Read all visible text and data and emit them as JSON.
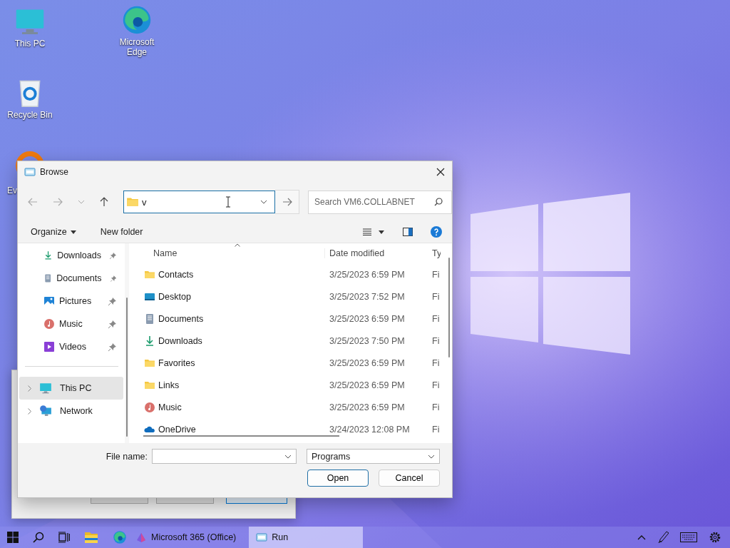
{
  "desktop": {
    "icons": [
      {
        "label": "This PC",
        "kind": "pc"
      },
      {
        "label": "Microsoft Edge",
        "kind": "edge"
      },
      {
        "label": "Recycle Bin",
        "kind": "bin"
      },
      {
        "label": "Ev",
        "kind": "app"
      }
    ]
  },
  "run_dialog": {
    "buttons": [
      {
        "selected": false
      },
      {
        "selected": false
      },
      {
        "selected": true
      }
    ]
  },
  "browse": {
    "title": "Browse",
    "address": "v",
    "search_placeholder": "Search VM6.COLLABNET",
    "toolbar": [
      "Organize",
      "New folder"
    ],
    "sidebar": {
      "quick": [
        {
          "label": "Downloads",
          "kind": "downloads"
        },
        {
          "label": "Documents",
          "kind": "documents"
        },
        {
          "label": "Pictures",
          "kind": "pictures"
        },
        {
          "label": "Music",
          "kind": "music"
        },
        {
          "label": "Videos",
          "kind": "videos"
        }
      ],
      "locations": [
        {
          "label": "This PC",
          "kind": "pc",
          "selected": true
        },
        {
          "label": "Network",
          "kind": "network",
          "selected": false
        }
      ]
    },
    "columns": [
      "Name",
      "Date modified",
      "Ty"
    ],
    "files": [
      {
        "name": "Contacts",
        "kind": "folder",
        "date": "3/25/2023 6:59 PM",
        "type": "Fi"
      },
      {
        "name": "Desktop",
        "kind": "desktop",
        "date": "3/25/2023 7:52 PM",
        "type": "Fi"
      },
      {
        "name": "Documents",
        "kind": "documents",
        "date": "3/25/2023 6:59 PM",
        "type": "Fi"
      },
      {
        "name": "Downloads",
        "kind": "downloads",
        "date": "3/25/2023 7:50 PM",
        "type": "Fi"
      },
      {
        "name": "Favorites",
        "kind": "folder",
        "date": "3/25/2023 6:59 PM",
        "type": "Fi"
      },
      {
        "name": "Links",
        "kind": "folder",
        "date": "3/25/2023 6:59 PM",
        "type": "Fi"
      },
      {
        "name": "Music",
        "kind": "music",
        "date": "3/25/2023 6:59 PM",
        "type": "Fi"
      },
      {
        "name": "OneDrive",
        "kind": "cloud",
        "date": "3/24/2023 12:08 PM",
        "type": "Fi"
      }
    ],
    "file_name_label": "File name:",
    "file_type": "Programs",
    "buttons": [
      {
        "label": "Open",
        "selected": true
      },
      {
        "label": "Cancel",
        "selected": false
      }
    ]
  },
  "taskbar": {
    "apps": [
      {
        "label": "Microsoft 365 (Office)",
        "kind": "office",
        "selected": false
      },
      {
        "label": "Run",
        "kind": "run",
        "selected": true
      }
    ]
  }
}
